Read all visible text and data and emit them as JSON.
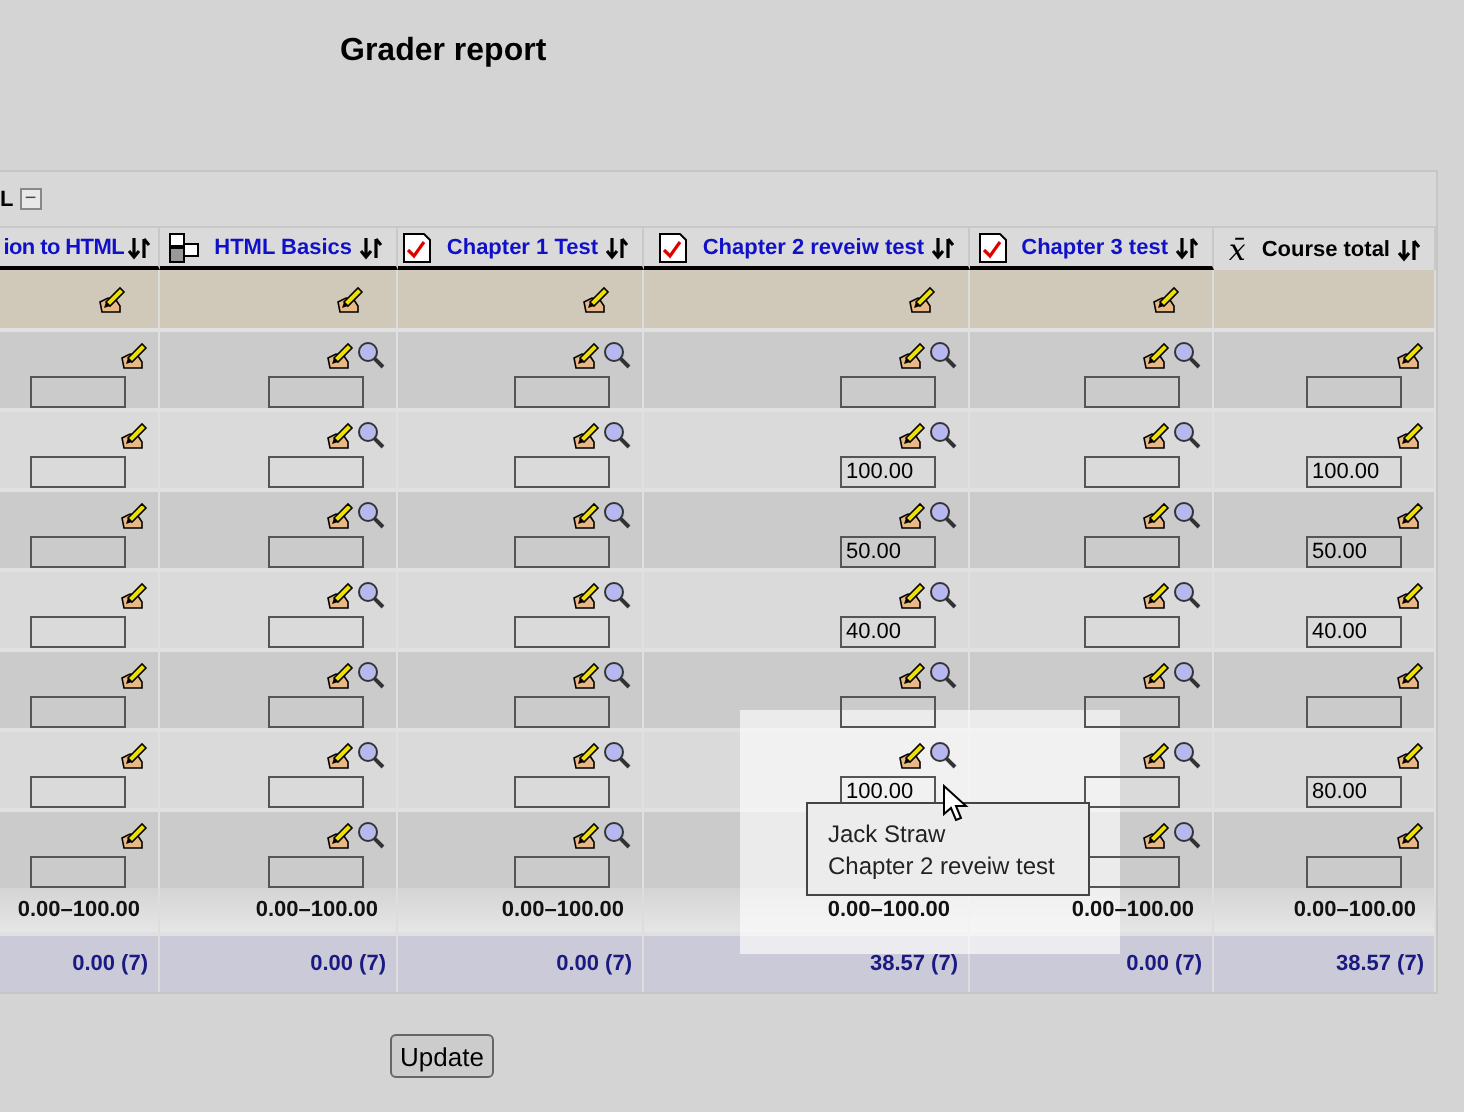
{
  "page": {
    "title": "Grader report"
  },
  "panel": {
    "heading": "L",
    "collapse_symbol": "−"
  },
  "columns": [
    {
      "label": "ion to HTML",
      "kind": "plain",
      "link": true
    },
    {
      "label": "HTML Basics",
      "kind": "category",
      "link": true
    },
    {
      "label": "Chapter 1 Test",
      "kind": "quiz",
      "link": true
    },
    {
      "label": "Chapter 2 reveiw test",
      "kind": "quiz",
      "link": true
    },
    {
      "label": "Chapter 3 test",
      "kind": "quiz",
      "link": true
    },
    {
      "label": "Course total",
      "kind": "total",
      "symbol": "x̄",
      "link": false
    }
  ],
  "category_row": [
    {
      "editable": true
    },
    {
      "editable": true
    },
    {
      "editable": true
    },
    {
      "editable": true
    },
    {
      "editable": true
    },
    {
      "editable": false
    }
  ],
  "students": [
    {
      "cells": [
        {},
        {},
        {},
        {},
        {},
        {}
      ]
    },
    {
      "cells": [
        {},
        {},
        {},
        {
          "value": "100.00"
        },
        {},
        {
          "value": "100.00"
        }
      ]
    },
    {
      "cells": [
        {},
        {},
        {},
        {
          "value": "50.00"
        },
        {},
        {
          "value": "50.00"
        }
      ]
    },
    {
      "cells": [
        {},
        {},
        {},
        {
          "value": "40.00"
        },
        {},
        {
          "value": "40.00"
        }
      ]
    },
    {
      "cells": [
        {},
        {},
        {},
        {},
        {},
        {}
      ]
    },
    {
      "cells": [
        {},
        {},
        {},
        {
          "value": "100.00"
        },
        {},
        {
          "value": "80.00"
        }
      ]
    },
    {
      "cells": [
        {},
        {},
        {},
        {
          "obscured": true
        },
        {},
        {}
      ]
    }
  ],
  "range_row": [
    "0.00–100.00",
    "0.00–100.00",
    "0.00–100.00",
    "0.00–100.00",
    "0.00–100.00",
    "0.00–100.00"
  ],
  "average_row": [
    "0.00 (7)",
    "0.00 (7)",
    "0.00 (7)",
    "38.57 (7)",
    "0.00 (7)",
    "38.57 (7)"
  ],
  "tooltip": {
    "lines": [
      "Jack Straw",
      "Chapter 2 reveiw test"
    ]
  },
  "update_button": {
    "label": "Update"
  }
}
